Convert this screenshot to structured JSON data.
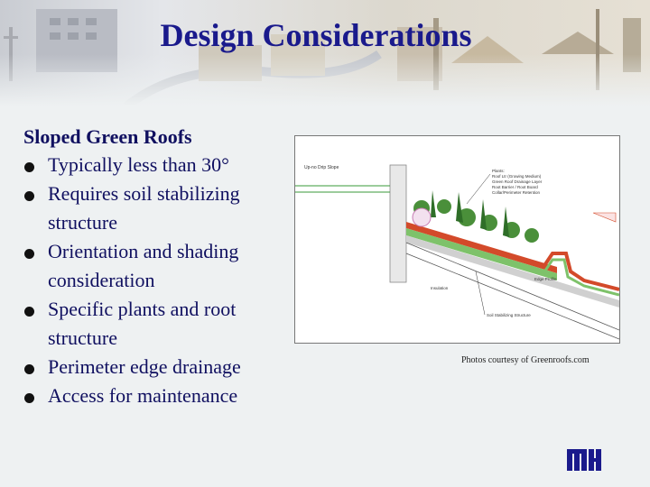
{
  "slide": {
    "title": "Design Considerations",
    "heading": "Sloped Green Roofs",
    "bullets": [
      "Typically less than 30°",
      "Requires soil stabilizing structure",
      "Orientation and shading consideration",
      "Specific plants and root structure",
      "Perimeter edge drainage",
      "Access for maintenance"
    ],
    "caption": "Photos courtesy of Greenroofs.com"
  },
  "figure": {
    "labels": [
      "Up-no Drip Slope",
      "Plants:",
      "Roof Ltr (Growing Medium)",
      "Green Roof Drainage Layer",
      "Root Barrier / Root Board",
      "Collar/Perimeter Retention",
      "Insulation",
      "Soil Stabilizing Structure",
      "Edge Profile"
    ]
  },
  "colors": {
    "title": "#1a1a8c",
    "text": "#101060",
    "bullet": "#111111",
    "background": "#eef1f2"
  }
}
